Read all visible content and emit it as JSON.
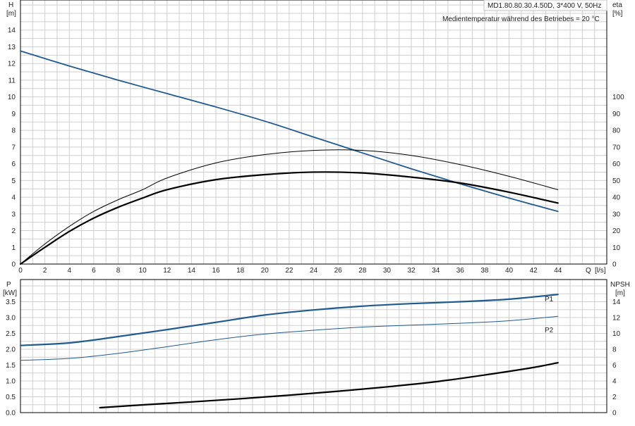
{
  "colors": {
    "background": "#ffffff",
    "grid": "#cfcfcf",
    "frame": "#000000",
    "head_curve": "#1f5a92",
    "power_curve": "#1f5a92",
    "eta_curve": "#000000",
    "npsh_curve": "#000000",
    "text": "#222222"
  },
  "header": {
    "model": "MD1.80.80.30.4.50D, 3*400 V, 50Hz",
    "medium_temp": "Medientemperatur während des Betriebes = 20 °C"
  },
  "chart_data": [
    {
      "type": "line",
      "x_axis": {
        "name": "Q",
        "unit": "[l/s]",
        "range": [
          0,
          48
        ],
        "ticks": [
          0,
          2,
          4,
          6,
          8,
          10,
          12,
          14,
          16,
          18,
          20,
          22,
          24,
          26,
          28,
          30,
          32,
          34,
          36,
          38,
          40,
          42,
          44
        ]
      },
      "y_axis_left": {
        "name": "H",
        "unit": "[m]",
        "range": [
          0,
          15.8
        ],
        "ticks": [
          0,
          1,
          2,
          3,
          4,
          5,
          6,
          7,
          8,
          9,
          10,
          11,
          12,
          13,
          14
        ]
      },
      "y_axis_right": {
        "name": "eta",
        "unit": "[%]",
        "range": [
          0,
          158
        ],
        "ticks": [
          0,
          10,
          20,
          30,
          40,
          50,
          60,
          70,
          80,
          90,
          100
        ]
      },
      "grid": true,
      "series": [
        {
          "axis": "left",
          "x": [
            0,
            4,
            8,
            12,
            16,
            20,
            24,
            28,
            32,
            36,
            40,
            44
          ],
          "y": [
            12.75,
            11.85,
            11.0,
            10.2,
            9.4,
            8.55,
            7.6,
            6.65,
            5.7,
            4.8,
            3.95,
            3.15
          ]
        },
        {
          "axis": "right",
          "x": [
            0,
            2,
            4,
            6,
            8,
            10,
            12,
            16,
            20,
            24,
            28,
            32,
            36,
            40,
            44
          ],
          "y": [
            0,
            12,
            22.5,
            31.5,
            38.5,
            44.5,
            51.5,
            60.5,
            65.5,
            68.0,
            68.0,
            65.0,
            59.5,
            52.5,
            44.5
          ]
        },
        {
          "axis": "right",
          "x": [
            0,
            2,
            4,
            6,
            8,
            10,
            12,
            16,
            20,
            24,
            28,
            32,
            36,
            40,
            44
          ],
          "y": [
            0,
            10,
            19.5,
            27.5,
            34.0,
            39.5,
            44.5,
            50.5,
            53.5,
            55.0,
            54.5,
            52.0,
            48.5,
            43.0,
            36.5
          ]
        }
      ]
    },
    {
      "type": "line",
      "x_axis": {
        "name": "Q",
        "unit": "[l/s]",
        "range": [
          0,
          48
        ]
      },
      "y_axis_left": {
        "name": "P",
        "unit": "[kW]",
        "range": [
          0,
          4.2
        ],
        "ticks": [
          0.0,
          0.5,
          1.0,
          1.5,
          2.0,
          2.5,
          3.0,
          3.5
        ]
      },
      "y_axis_right": {
        "name": "NPSH",
        "unit": "[m]",
        "range": [
          0,
          16.8
        ],
        "ticks": [
          0,
          2,
          4,
          6,
          8,
          10,
          12,
          14
        ]
      },
      "grid": true,
      "series": [
        {
          "name": "P1",
          "axis": "left",
          "x": [
            0,
            4,
            8,
            12,
            16,
            20,
            24,
            28,
            32,
            36,
            40,
            44
          ],
          "y": [
            2.12,
            2.2,
            2.4,
            2.62,
            2.85,
            3.08,
            3.24,
            3.36,
            3.44,
            3.5,
            3.58,
            3.73
          ]
        },
        {
          "name": "P2",
          "axis": "left",
          "x": [
            0,
            4,
            8,
            12,
            16,
            20,
            24,
            28,
            32,
            36,
            40,
            44
          ],
          "y": [
            1.65,
            1.71,
            1.87,
            2.08,
            2.3,
            2.48,
            2.6,
            2.7,
            2.76,
            2.82,
            2.9,
            3.04
          ]
        },
        {
          "axis": "right",
          "x": [
            6.5,
            10,
            14,
            18,
            22,
            26,
            30,
            34,
            38,
            42,
            44
          ],
          "y": [
            0.62,
            0.98,
            1.35,
            1.75,
            2.2,
            2.7,
            3.25,
            3.9,
            4.75,
            5.7,
            6.3
          ]
        }
      ]
    }
  ]
}
